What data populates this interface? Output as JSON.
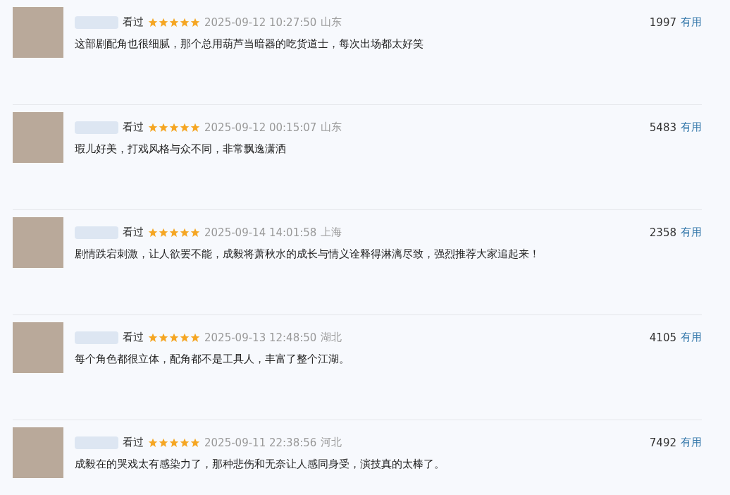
{
  "reviews": [
    {
      "status": "看过",
      "stars": 5,
      "time": "2025-09-12 10:27:50",
      "location": "山东",
      "votes": "1997",
      "vote_label": "有用",
      "text": "这部剧配角也很细腻，那个总用葫芦当暗器的吃货道士，每次出场都太好笑"
    },
    {
      "status": "看过",
      "stars": 5,
      "time": "2025-09-12 00:15:07",
      "location": "山东",
      "votes": "5483",
      "vote_label": "有用",
      "text": "瑕儿好美，打戏风格与众不同，非常飘逸潇洒"
    },
    {
      "status": "看过",
      "stars": 5,
      "time": "2025-09-14 14:01:58",
      "location": "上海",
      "votes": "2358",
      "vote_label": "有用",
      "text": "剧情跌宕刺激，让人欲罢不能，成毅将萧秋水的成长与情义诠释得淋漓尽致，强烈推荐大家追起来！"
    },
    {
      "status": "看过",
      "stars": 5,
      "time": "2025-09-13 12:48:50",
      "location": "湖北",
      "votes": "4105",
      "vote_label": "有用",
      "text": "每个角色都很立体，配角都不是工具人，丰富了整个江湖。"
    },
    {
      "status": "看过",
      "stars": 5,
      "time": "2025-09-11 22:38:56",
      "location": "河北",
      "votes": "7492",
      "vote_label": "有用",
      "text": "成毅在的哭戏太有感染力了，那种悲伤和无奈让人感同身受，演技真的太棒了。"
    }
  ]
}
